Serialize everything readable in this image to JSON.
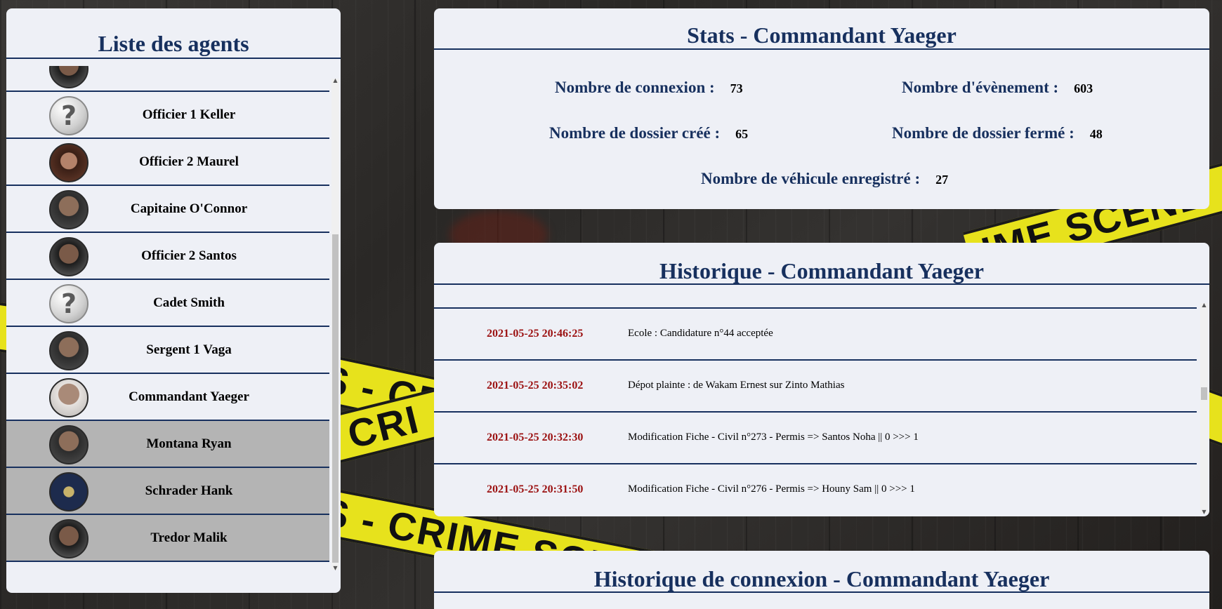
{
  "agents": {
    "title": "Liste des agents",
    "items": [
      {
        "name": "",
        "avatar": "face2",
        "selected": false
      },
      {
        "name": "Officier 1 Keller",
        "avatar": "unknown",
        "selected": false
      },
      {
        "name": "Officier 2 Maurel",
        "avatar": "woman",
        "selected": false
      },
      {
        "name": "Capitaine O'Connor",
        "avatar": "face",
        "selected": false
      },
      {
        "name": "Officier 2 Santos",
        "avatar": "face2",
        "selected": false
      },
      {
        "name": "Cadet Smith",
        "avatar": "unknown",
        "selected": false
      },
      {
        "name": "Sergent 1 Vaga",
        "avatar": "face",
        "selected": false
      },
      {
        "name": "Commandant Yaeger",
        "avatar": "face3",
        "selected": false
      },
      {
        "name": "Montana Ryan",
        "avatar": "face",
        "selected": true
      },
      {
        "name": "Schrader Hank",
        "avatar": "seal",
        "selected": true
      },
      {
        "name": "Tredor Malik",
        "avatar": "face2",
        "selected": true
      }
    ]
  },
  "stats": {
    "title": "Stats - Commandant Yaeger",
    "connexions_label": "Nombre de connexion :",
    "connexions_value": "73",
    "evenements_label": "Nombre d'évènement :",
    "evenements_value": "603",
    "dossiers_crees_label": "Nombre de dossier créé :",
    "dossiers_crees_value": "65",
    "dossiers_fermes_label": "Nombre de dossier fermé :",
    "dossiers_fermes_value": "48",
    "vehicules_label": "Nombre de véhicule enregistré :",
    "vehicules_value": "27"
  },
  "history": {
    "title": "Historique - Commandant Yaeger",
    "entries": [
      {
        "date": "2021-05-25 20:46:25",
        "text": "Ecole : Candidature n°44 acceptée"
      },
      {
        "date": "2021-05-25 20:35:02",
        "text": "Dépot plainte : de Wakam Ernest sur Zinto Mathias"
      },
      {
        "date": "2021-05-25 20:32:30",
        "text": "Modification Fiche - Civil n°273 - Permis => Santos Noha || 0 >>> 1"
      },
      {
        "date": "2021-05-25 20:31:50",
        "text": "Modification Fiche - Civil n°276 - Permis => Houny Sam || 0 >>> 1"
      }
    ]
  },
  "connexion": {
    "title": "Historique de connexion - Commandant Yaeger"
  },
  "background": {
    "tape_text_1": "S - CR",
    "tape_text_2": "- CRI",
    "tape_text_3": "S - CRIME SCENE DO N",
    "tape_text_4": "IME SCENE",
    "tape_color": "#e7e21c"
  },
  "colors": {
    "accent": "#17305e",
    "date": "#9b1010",
    "panel": "#eef0f6",
    "selected_row": "#b4b4b4"
  }
}
